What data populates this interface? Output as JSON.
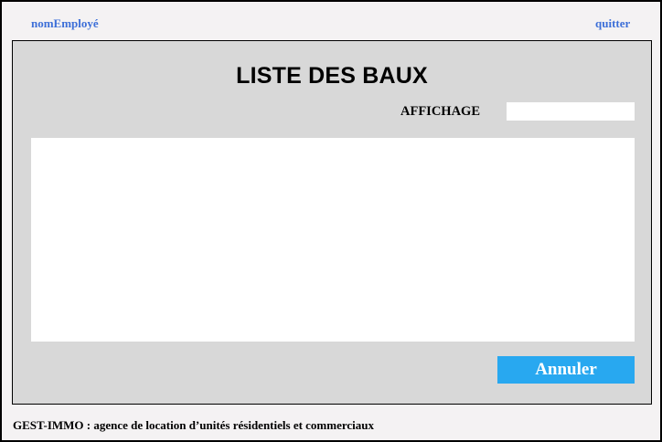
{
  "header": {
    "user_link": "nomEmployé",
    "quit_link": "quitter"
  },
  "main": {
    "title": "LISTE DES BAUX",
    "affichage_label": "AFFICHAGE",
    "affichage_value": "",
    "list_items": [],
    "cancel_label": "Annuler"
  },
  "footer": {
    "text": "GEST-IMMO : agence de location d’unités résidentiels et commerciaux"
  },
  "colors": {
    "link": "#3d6fd8",
    "panel": "#d8d8d8",
    "button": "#28a8f0",
    "background": "#f4f2f3"
  }
}
